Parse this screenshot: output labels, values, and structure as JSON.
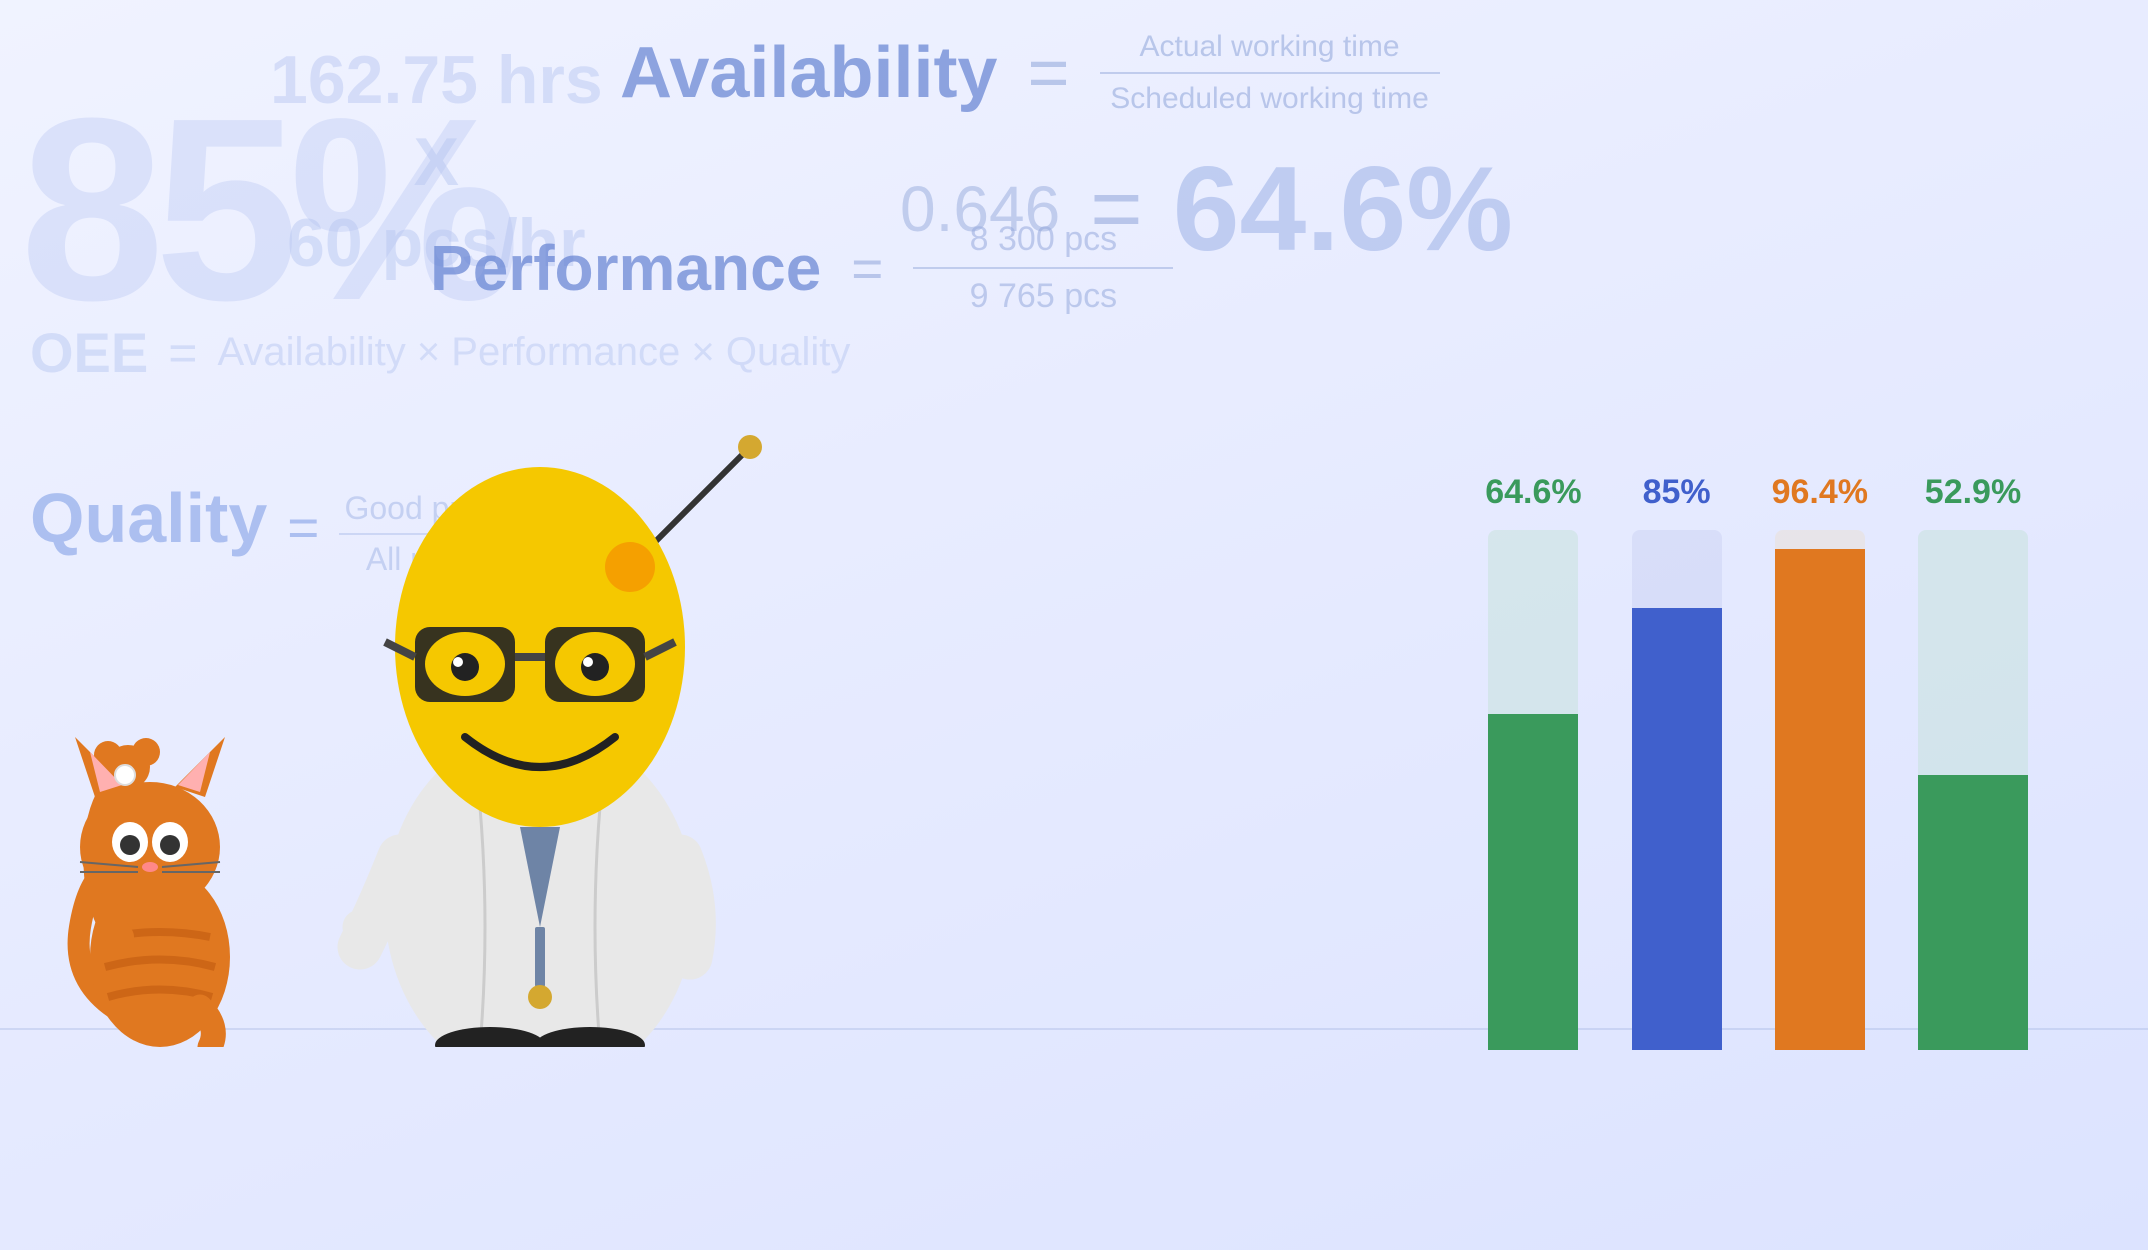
{
  "background": {
    "large_percent": "85%",
    "hrs_line1": "162.75 hrs",
    "hrs_line2": "X",
    "hrs_line3": "60 pcs/hr",
    "oee_label": "OEE",
    "oee_equals": "=",
    "oee_formula": "Availability × Performance × Quality"
  },
  "quality": {
    "label": "Quality",
    "equals": "=",
    "numerator": "Good products",
    "denominator": "All products"
  },
  "availability": {
    "label": "Availability",
    "equals": "=",
    "numerator": "Actual working time",
    "denominator": "Scheduled working time",
    "decimal": "0.646",
    "equals2": "=",
    "percent": "64.6%"
  },
  "performance": {
    "label": "Performance",
    "equals": "=",
    "numerator": "8 300 pcs",
    "denominator": "9 765 pcs"
  },
  "chart": {
    "bars": [
      {
        "id": "availability",
        "label": "64.6%",
        "label_color": "#3a9a5c",
        "total_height": 520,
        "filled_height": 336,
        "upper_color": "#b8dfc8",
        "lower_color": "#3a9a5c"
      },
      {
        "id": "performance",
        "label": "85%",
        "label_color": "#4060cc",
        "total_height": 520,
        "filled_height": 442,
        "upper_color": "#c0c8ee",
        "lower_color": "#4060cc"
      },
      {
        "id": "quality",
        "label": "96.4%",
        "label_color": "#e07820",
        "total_height": 520,
        "filled_height": 501,
        "upper_color": "#eedcc0",
        "lower_color": "#e07820"
      },
      {
        "id": "oee",
        "label": "52.9%",
        "label_color": "#3a9a5c",
        "total_height": 520,
        "filled_height": 275,
        "upper_color": "#b8dfc8",
        "lower_color": "#3a9a5c"
      }
    ]
  }
}
